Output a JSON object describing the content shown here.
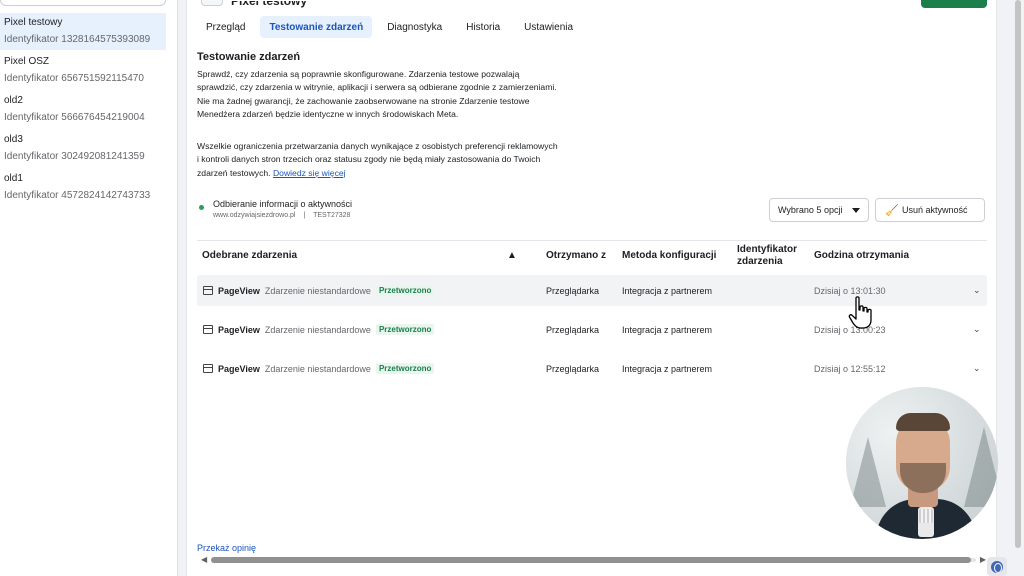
{
  "sidebar": {
    "pixels": [
      {
        "name": "Pixel testowy",
        "id": "Identyfikator 1328164575393089",
        "active": true
      },
      {
        "name": "Pixel OSZ",
        "id": "Identyfikator 656751592115470"
      },
      {
        "name": "old2",
        "id": "Identyfikator 566676454219004"
      },
      {
        "name": "old3",
        "id": "Identyfikator 302492081241359"
      },
      {
        "name": "old1",
        "id": "Identyfikator 4572824142743733"
      }
    ]
  },
  "header": {
    "title": "Pixel testowy"
  },
  "tabs": [
    {
      "label": "Przegląd"
    },
    {
      "label": "Testowanie zdarzeń",
      "active": true
    },
    {
      "label": "Diagnostyka"
    },
    {
      "label": "Historia"
    },
    {
      "label": "Ustawienia"
    }
  ],
  "section": {
    "title": "Testowanie zdarzeń",
    "line1": "Sprawdź, czy zdarzenia są poprawnie skonfigurowane. Zdarzenia testowe pozwalają",
    "line2": "sprawdzić, czy zdarzenia w witrynie, aplikacji i serwera są odbierane zgodnie z zamierzeniami.",
    "line3": "Nie ma żadnej gwarancji, że zachowanie zaobserwowane na stronie Zdarzenie testowe",
    "line4": "Menedżera zdarzeń będzie identyczne w innych środowiskach Meta.",
    "p2_line1": "Wszelkie ograniczenia przetwarzania danych wynikające z osobistych preferencji reklamowych",
    "p2_line2": "i kontroli danych stron trzecich oraz statusu zgody nie będą miały zastosowania do Twoich",
    "p2_line3": "zdarzeń testowych.",
    "learn_more": "Dowiedz się więcej"
  },
  "activity": {
    "title": "Odbieranie informacji o aktywności",
    "site": "www.odzywiajsiezdrowo.pl",
    "separator": "|",
    "code": "TEST27328",
    "status_color": "#23a455"
  },
  "controls": {
    "filter_label": "Wybrano 5 opcji",
    "clear_label": "Usuń aktywność"
  },
  "table": {
    "headers": {
      "received": "Odebrane zdarzenia",
      "warning_icon": "warning-icon",
      "source": "Otrzymano z",
      "method": "Metoda konfiguracji",
      "id_line1": "Identyfikator",
      "id_line2": "zdarzenia",
      "time": "Godzina otrzymania"
    },
    "rows": [
      {
        "event": "PageView",
        "type": "Zdarzenie niestandardowe",
        "status": "Przetworzono",
        "source": "Przeglądarka",
        "method": "Integracja z partnerem",
        "time": "Dzisiaj o 13:01:30"
      },
      {
        "event": "PageView",
        "type": "Zdarzenie niestandardowe",
        "status": "Przetworzono",
        "source": "Przeglądarka",
        "method": "Integracja z partnerem",
        "time": "Dzisiaj o 13:00:23"
      },
      {
        "event": "PageView",
        "type": "Zdarzenie niestandardowe",
        "status": "Przetworzono",
        "source": "Przeglądarka",
        "method": "Integracja z partnerem",
        "time": "Dzisiaj o 12:55:12"
      }
    ]
  },
  "footer": {
    "feedback": "Przekaż opinię"
  },
  "colors": {
    "accent": "#1a56b8",
    "success": "#1a7f4b",
    "active_tab_bg": "#e7f0fd"
  }
}
